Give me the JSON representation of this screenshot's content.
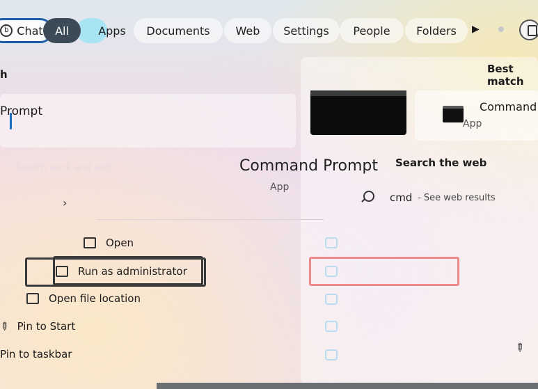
{
  "tabs": [
    {
      "label": "Chat"
    },
    {
      "label": "All"
    },
    {
      "label": "Apps"
    },
    {
      "label": "Documents"
    },
    {
      "label": "Web"
    },
    {
      "label": "Settings"
    },
    {
      "label": "People"
    },
    {
      "label": "Folders"
    }
  ],
  "best_match": {
    "label": "Best match"
  },
  "result": {
    "title": "Prompt",
    "faded": "Search work and web"
  },
  "detail": {
    "title": "Command Prompt",
    "subtitle": "App"
  },
  "small_result": {
    "title": "Command",
    "subtitle": "App"
  },
  "search_web": {
    "label": "Search the web",
    "query": "cmd",
    "hint": "- See web results"
  },
  "actions": {
    "open": "Open",
    "run_admin": "Run as administrator",
    "open_location": "Open file location",
    "pin_start": "Pin to Start",
    "pin_taskbar": "Pin to taskbar"
  }
}
